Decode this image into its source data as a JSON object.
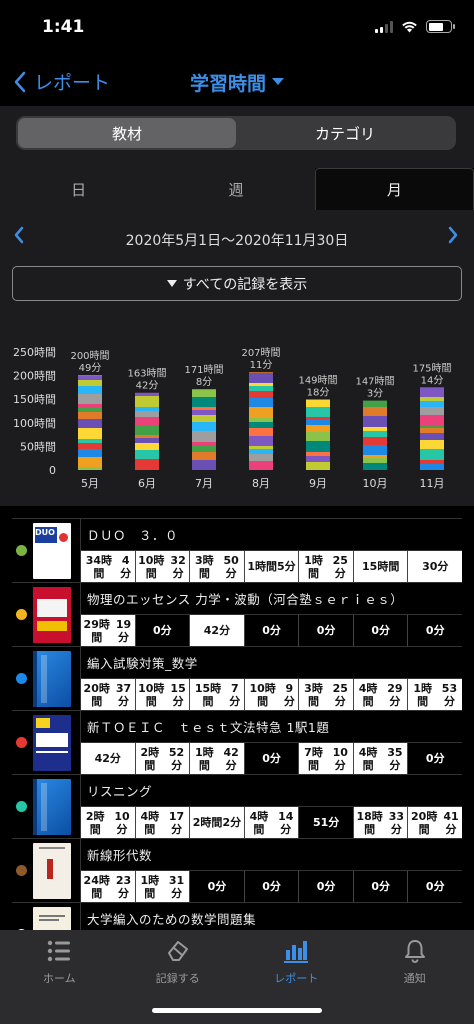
{
  "status": {
    "time": "1:41"
  },
  "nav": {
    "back_label": "レポート",
    "title": "学習時間"
  },
  "segments": [
    "教材",
    "カテゴリ"
  ],
  "period_tabs": [
    "日",
    "週",
    "月"
  ],
  "range": {
    "text": "2020年5月1日〜2020年11月30日"
  },
  "show_all_label": "すべての記録を表示",
  "chart_data": {
    "type": "bar",
    "stacked": true,
    "categories": [
      "5月",
      "6月",
      "7月",
      "8月",
      "9月",
      "10月",
      "11月"
    ],
    "values_minutes": [
      12049,
      9822,
      10268,
      12431,
      8958,
      8823,
      10514
    ],
    "total_labels": [
      [
        "200時間",
        "49分"
      ],
      [
        "163時間",
        "42分"
      ],
      [
        "171時間",
        "8分"
      ],
      [
        "207時間",
        "11分"
      ],
      [
        "149時間",
        "18分"
      ],
      [
        "147時間",
        "3分"
      ],
      [
        "175時間",
        "14分"
      ]
    ],
    "ylim": [
      0,
      250
    ],
    "yticks": [
      "0",
      "50時間",
      "100時間",
      "150時間",
      "200時間",
      "250時間"
    ],
    "segment_colors": [
      "#8bc34a",
      "#f0a020",
      "#1e88e5",
      "#e53935",
      "#26c6a6",
      "#fdd835",
      "#6a4fb5",
      "#e07b2a",
      "#43a047",
      "#ec407a",
      "#9e9e9e",
      "#29b6f6",
      "#c0ca33",
      "#7e57c2",
      "#ff7043",
      "#00897b"
    ]
  },
  "books": [
    {
      "title": "ＤＵＯ　３．０",
      "dot": "#7cb342",
      "cover": "duo",
      "cells": [
        [
          "34時間",
          "4分"
        ],
        [
          "10時間",
          "32分"
        ],
        [
          "3時間",
          "50分"
        ],
        [
          "1時間",
          "5分"
        ],
        [
          "1時間",
          "25分"
        ],
        [
          "15時間",
          ""
        ],
        [
          "30分",
          ""
        ]
      ],
      "dark": [
        false,
        false,
        false,
        false,
        false,
        false,
        false
      ]
    },
    {
      "title": "物理のエッセンス 力学・波動（河合塾ｓｅｒｉｅｓ）",
      "dot": "#f2b521",
      "cover": "physics",
      "cells": [
        [
          "29時間",
          "19分"
        ],
        [
          "0分",
          ""
        ],
        [
          "42分",
          ""
        ],
        [
          "0分",
          ""
        ],
        [
          "0分",
          ""
        ],
        [
          "0分",
          ""
        ],
        [
          "0分",
          ""
        ]
      ],
      "dark": [
        false,
        true,
        false,
        true,
        true,
        true,
        true
      ]
    },
    {
      "title": "編入試験対策_数学",
      "dot": "#1e88e5",
      "cover": "blue",
      "cells": [
        [
          "20時間",
          "37分"
        ],
        [
          "10時間",
          "15分"
        ],
        [
          "15時間",
          "7分"
        ],
        [
          "10時間",
          "9分"
        ],
        [
          "3時間",
          "25分"
        ],
        [
          "4時間",
          "29分"
        ],
        [
          "1時間",
          "53分"
        ]
      ],
      "dark": [
        false,
        false,
        false,
        false,
        false,
        false,
        false
      ]
    },
    {
      "title": "新ＴＯＥＩＣ　ｔｅｓｔ文法特急 1駅1題",
      "dot": "#e53935",
      "cover": "toeic",
      "cells": [
        [
          "42分",
          ""
        ],
        [
          "2時間",
          "52分"
        ],
        [
          "1時間",
          "42分"
        ],
        [
          "0分",
          ""
        ],
        [
          "7時間",
          "10分"
        ],
        [
          "4時間",
          "35分"
        ],
        [
          "0分",
          ""
        ]
      ],
      "dark": [
        false,
        false,
        false,
        true,
        false,
        false,
        true
      ]
    },
    {
      "title": "リスニング",
      "dot": "#26c6a6",
      "cover": "blue",
      "cells": [
        [
          "2時間",
          "10分"
        ],
        [
          "4時間",
          "17分"
        ],
        [
          "2時間",
          "2分"
        ],
        [
          "4時間",
          "14分"
        ],
        [
          "51分",
          ""
        ],
        [
          "18時間",
          "33分"
        ],
        [
          "20時間",
          "41分"
        ]
      ],
      "dark": [
        false,
        false,
        false,
        false,
        true,
        false,
        false
      ]
    },
    {
      "title": "新線形代数",
      "dot": "#8d5a2b",
      "cover": "linalg",
      "cells": [
        [
          "24時間",
          "23分"
        ],
        [
          "1時間",
          "31分"
        ],
        [
          "0分",
          ""
        ],
        [
          "0分",
          ""
        ],
        [
          "0分",
          ""
        ],
        [
          "0分",
          ""
        ],
        [
          "0分",
          ""
        ]
      ],
      "dark": [
        false,
        false,
        true,
        true,
        true,
        true,
        true
      ]
    },
    {
      "title": "大学編入のための数学問題集",
      "dot": "#ffffff",
      "cover": "math",
      "cells": [
        [
          "",
          ""
        ],
        [
          "",
          ""
        ],
        [
          "",
          ""
        ],
        [
          "",
          ""
        ],
        [
          "",
          ""
        ],
        [
          "",
          ""
        ],
        [
          "",
          ""
        ]
      ],
      "dark": [
        false,
        false,
        false,
        false,
        false,
        false,
        false
      ]
    }
  ],
  "tabbar": [
    {
      "label": "ホーム",
      "icon": "list-icon"
    },
    {
      "label": "記録する",
      "icon": "eraser-icon"
    },
    {
      "label": "レポート",
      "icon": "bar-chart-icon"
    },
    {
      "label": "通知",
      "icon": "bell-icon"
    }
  ]
}
